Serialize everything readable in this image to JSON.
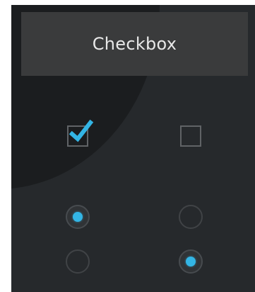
{
  "title": "Checkbox",
  "colors": {
    "accent": "#33b5e5",
    "background": "#26292c",
    "title_bar": "#3a3b3c"
  },
  "checkboxes": [
    {
      "checked": true
    },
    {
      "checked": false
    }
  ],
  "radios": [
    {
      "selected": true
    },
    {
      "selected": false
    },
    {
      "selected": false
    },
    {
      "selected": true
    }
  ]
}
